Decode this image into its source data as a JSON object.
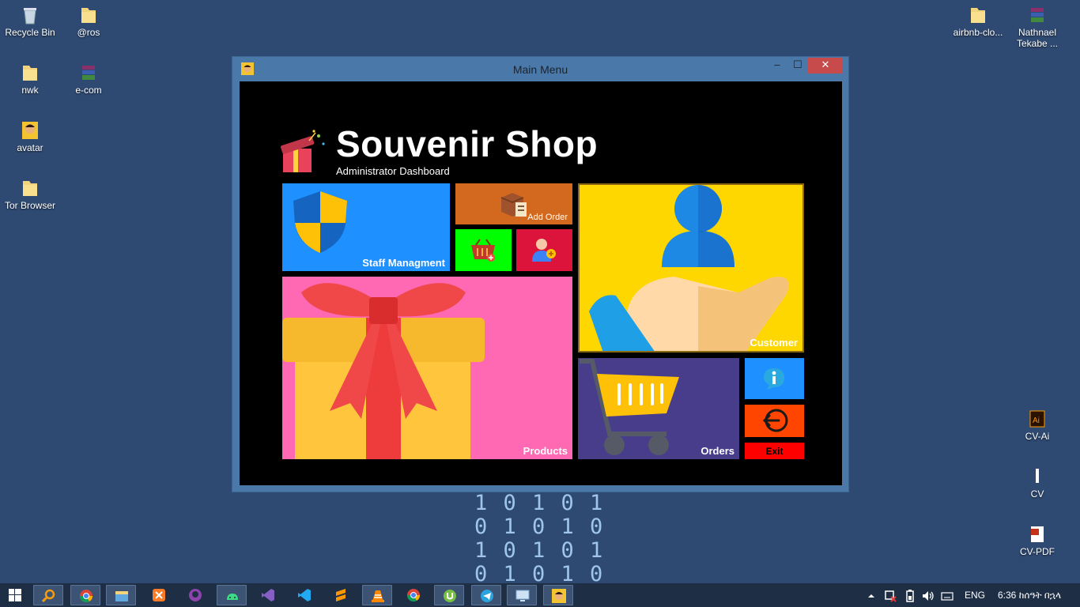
{
  "desktop": {
    "icons": [
      {
        "label": "Recycle Bin",
        "icon": "recycle-bin-icon"
      },
      {
        "label": "@ros",
        "icon": "folder-icon"
      },
      {
        "label": "nwk",
        "icon": "folder-icon"
      },
      {
        "label": "e-com",
        "icon": "winrar-archive-icon"
      },
      {
        "label": "avatar",
        "icon": "avatar-image-icon"
      },
      {
        "label": "Tor Browser",
        "icon": "folder-icon"
      },
      {
        "label": "airbnb-clo...",
        "icon": "folder-icon"
      },
      {
        "label": "Nathnael Tekabe ...",
        "icon": "winrar-archive-icon"
      },
      {
        "label": "CV-Ai",
        "icon": "illustrator-file-icon"
      },
      {
        "label": "CV",
        "icon": "document-icon"
      },
      {
        "label": "CV-PDF",
        "icon": "pdf-file-icon"
      }
    ],
    "binary_rows": [
      "1 0 1 0 1",
      "0 1 0 1 0",
      "1 0 1 0 1",
      "0 1 0 1 0",
      "    1"
    ]
  },
  "window": {
    "title": "Main Menu",
    "min_label": "–",
    "max_label": "☐",
    "close_label": "✕"
  },
  "app": {
    "brand_title": "Souvenir Shop",
    "brand_subtitle": "Administrator Dashboard",
    "tiles": {
      "staff": "Staff Managment",
      "add_order": "Add Order",
      "products": "Products",
      "customer": "Customer",
      "orders": "Orders",
      "exit": "Exit"
    },
    "colors": {
      "staff": "#1e90ff",
      "add_order": "#d2691e",
      "add_cart": "#00ff00",
      "add_user": "#dc143c",
      "products": "#ff69b4",
      "customer": "#ffd700",
      "orders": "#483d8b",
      "info": "#1e90ff",
      "logout": "#ff4500",
      "exit": "#ff0000"
    }
  },
  "taskbar": {
    "apps": [
      "search-icon",
      "chrome-icon",
      "file-explorer-icon",
      "xampp-icon",
      "github-icon",
      "android-studio-icon",
      "visual-studio-icon",
      "vscode-icon",
      "sublime-icon",
      "vlc-icon",
      "chrome-icon",
      "utorrent-icon",
      "telegram-icon",
      "remote-desktop-icon",
      "souvenir-app-icon"
    ],
    "language": "ENG",
    "clock": "6:36 ከሰዓት በኋላ"
  }
}
